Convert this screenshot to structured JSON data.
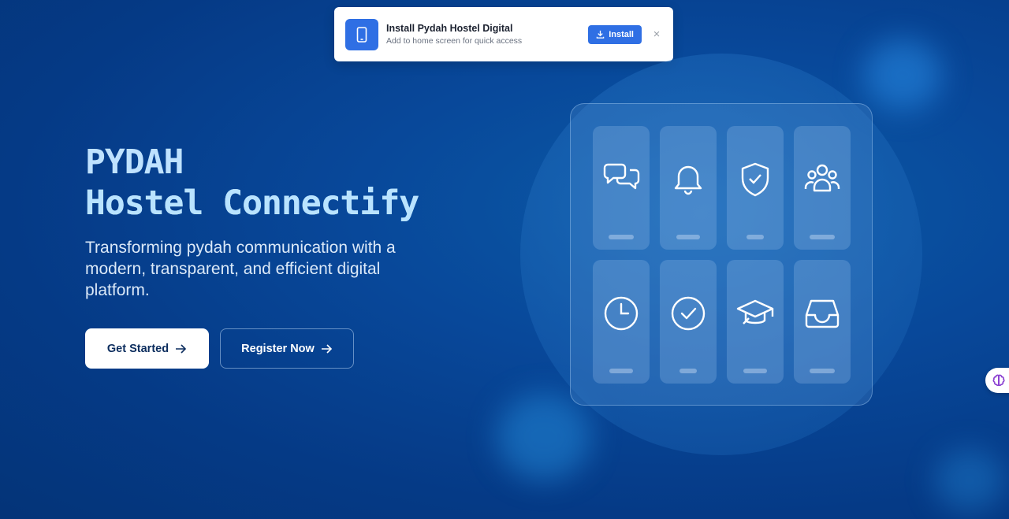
{
  "install_toast": {
    "title": "Install Pydah Hostel Digital",
    "subtitle": "Add to home screen for quick access",
    "install_label": "Install",
    "close_glyph": "×",
    "icon": "smartphone-icon"
  },
  "hero": {
    "title_line1": "PYDAH",
    "title_line2": "Hostel Connectify",
    "subtitle": "Transforming pydah communication with a modern, transparent, and efficient digital platform.",
    "primary_button": "Get Started",
    "secondary_button": "Register Now"
  },
  "feature_icons": [
    "chat-icon",
    "bell-icon",
    "shield-check-icon",
    "users-icon",
    "clock-icon",
    "check-circle-icon",
    "graduation-cap-icon",
    "inbox-icon"
  ],
  "colors": {
    "background": "#053a86",
    "accent": "#2f6fe4",
    "title": "#bfe2ff"
  }
}
